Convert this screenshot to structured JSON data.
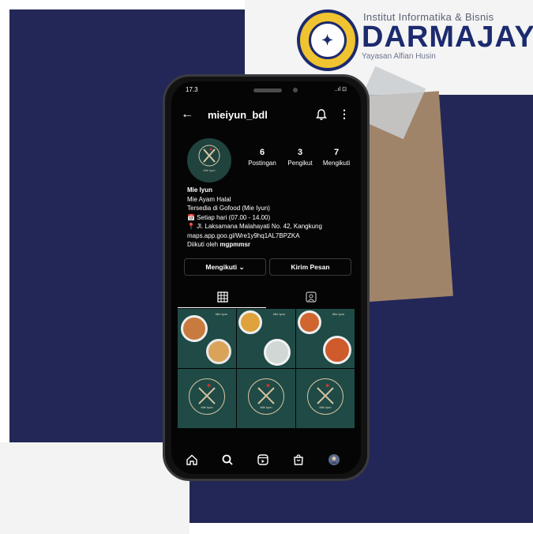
{
  "branding": {
    "institute_line": "Institut Informatika & Bisnis",
    "name": "DARMAJAYA",
    "foundation": "Yayasan Alfian Husin",
    "seal_text": "DARMAJAYA"
  },
  "status_bar": {
    "time": "17.3",
    "signal": "..ıl ⊡"
  },
  "topbar": {
    "username": "mieiyun_bdl",
    "back_icon": "arrow-left-icon",
    "bell_icon": "bell-icon",
    "menu_icon": "more-vert-icon"
  },
  "profile": {
    "stats": [
      {
        "value": "6",
        "label": "Postingan"
      },
      {
        "value": "3",
        "label": "Pengikut"
      },
      {
        "value": "7",
        "label": "Mengikuti"
      }
    ],
    "bio": {
      "name": "Mie Iyun",
      "line1": "Mie Ayam Halal",
      "line2": "Tersedia di Gofood (Mie Iyun)",
      "line3": "📅 Setiap hari (07.00 - 14.00)",
      "line4": "📍 Jl. Laksamana Malahayati No. 42, Kangkung",
      "link": "maps.app.goo.gl/Wre1y9hq1AL7BPZKA",
      "followed_prefix": "Diikuti oleh ",
      "followed_user": "mgpmmsr"
    },
    "buttons": {
      "following": "Mengikuti ⌄",
      "message": "Kirim Pesan"
    }
  },
  "tabs": [
    {
      "icon": "grid-icon"
    },
    {
      "icon": "tagged-person-icon"
    }
  ],
  "posts": [
    {
      "type": "menu",
      "caption": "Mie Iyun"
    },
    {
      "type": "menu",
      "caption": "Mie Iyun"
    },
    {
      "type": "menu",
      "caption": "Mie Iyun"
    },
    {
      "type": "logo",
      "caption": "Mie Iyun"
    },
    {
      "type": "logo",
      "caption": "Mie Iyun"
    },
    {
      "type": "logo",
      "caption": "Mie Iyun"
    }
  ],
  "bottom_nav": [
    {
      "icon": "home-icon"
    },
    {
      "icon": "search-icon"
    },
    {
      "icon": "reels-icon"
    },
    {
      "icon": "shop-icon"
    },
    {
      "icon": "profile-avatar-icon"
    }
  ],
  "colors": {
    "background_navy": "#232757",
    "brand_blue": "#1c2a6e",
    "post_green": "#1f4a46"
  }
}
